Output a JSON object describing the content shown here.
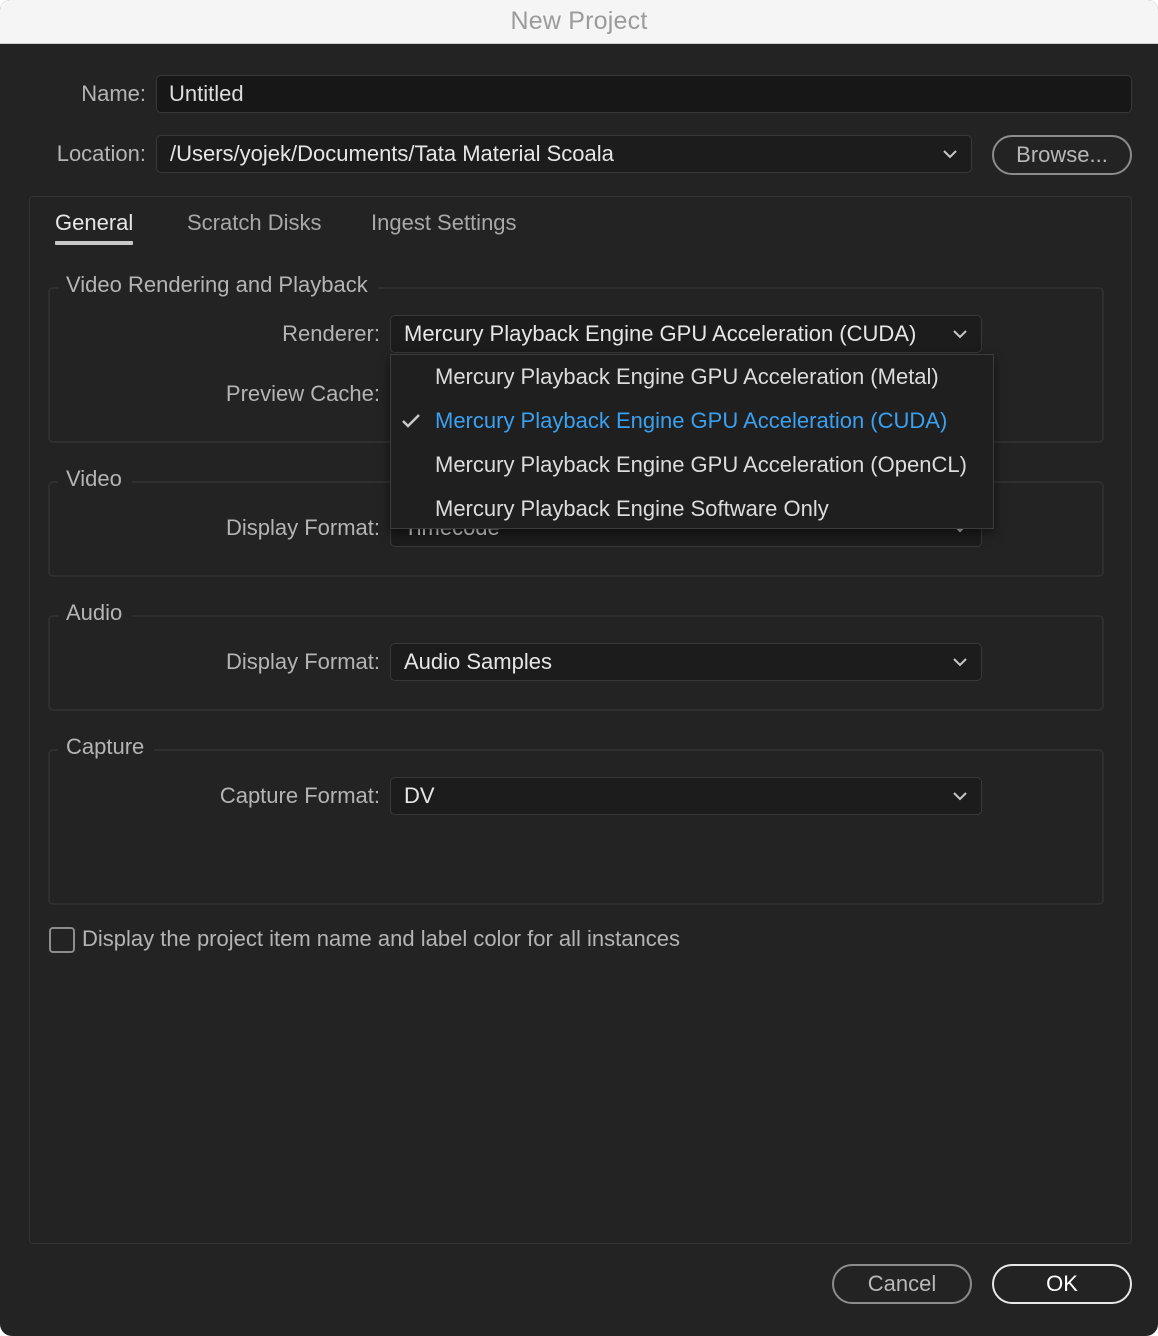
{
  "window": {
    "title": "New Project"
  },
  "form": {
    "name_label": "Name:",
    "name_value": "Untitled",
    "location_label": "Location:",
    "location_value": "/Users/yojek/Documents/Tata Material Scoala",
    "browse_label": "Browse..."
  },
  "tabs": [
    {
      "label": "General",
      "active": true
    },
    {
      "label": "Scratch Disks",
      "active": false
    },
    {
      "label": "Ingest Settings",
      "active": false
    }
  ],
  "sections": {
    "video_rendering": {
      "title": "Video Rendering and Playback",
      "renderer_label": "Renderer:",
      "renderer_value": "Mercury Playback Engine GPU Acceleration (CUDA)",
      "preview_cache_label": "Preview Cache:"
    },
    "video": {
      "title": "Video",
      "display_format_label": "Display Format:",
      "display_format_value": "Timecode"
    },
    "audio": {
      "title": "Audio",
      "display_format_label": "Display Format:",
      "display_format_value": "Audio Samples"
    },
    "capture": {
      "title": "Capture",
      "capture_format_label": "Capture Format:",
      "capture_format_value": "DV"
    }
  },
  "renderer_menu": {
    "items": [
      {
        "label": "Mercury Playback Engine GPU Acceleration (Metal)",
        "selected": false
      },
      {
        "label": "Mercury Playback Engine GPU Acceleration (CUDA)",
        "selected": true
      },
      {
        "label": "Mercury Playback Engine GPU Acceleration (OpenCL)",
        "selected": false
      },
      {
        "label": "Mercury Playback Engine Software Only",
        "selected": false
      }
    ],
    "selected_color": "#3aa0f0"
  },
  "options": {
    "display_item_name_label": "Display the project item name and label color for all instances",
    "display_item_name_checked": false
  },
  "footer": {
    "cancel_label": "Cancel",
    "ok_label": "OK"
  }
}
